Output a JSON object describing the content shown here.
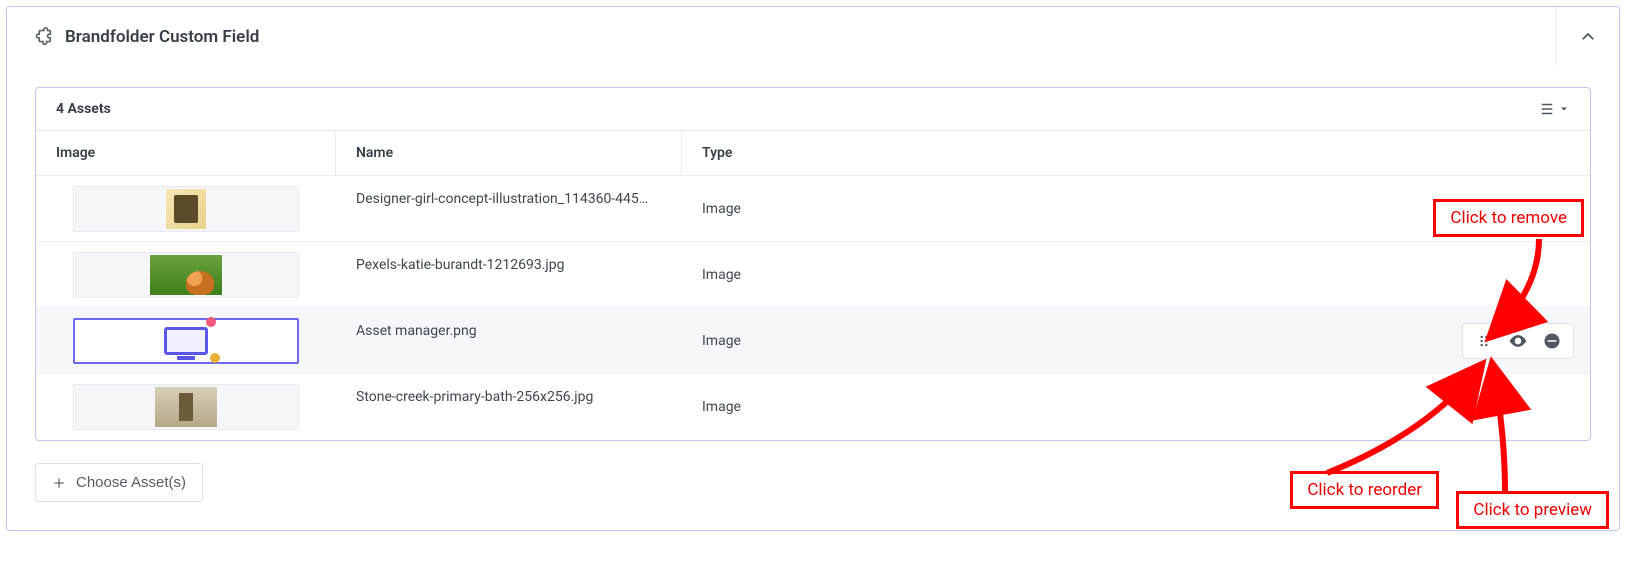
{
  "panel": {
    "title": "Brandfolder Custom Field"
  },
  "assets": {
    "header_text": "4 Assets",
    "columns": {
      "image": "Image",
      "name": "Name",
      "type": "Type"
    },
    "rows": [
      {
        "name": "Designer-girl-concept-illustration_114360-445…",
        "type": "Image",
        "thumb": "img1",
        "selected": false,
        "show_actions": false
      },
      {
        "name": "Pexels-katie-burandt-1212693.jpg",
        "type": "Image",
        "thumb": "img2",
        "selected": false,
        "show_actions": false
      },
      {
        "name": "Asset manager.png",
        "type": "Image",
        "thumb": "img3",
        "selected": true,
        "show_actions": true
      },
      {
        "name": "Stone-creek-primary-bath-256x256.jpg",
        "type": "Image",
        "thumb": "img4",
        "selected": false,
        "show_actions": false
      }
    ]
  },
  "choose_label": "Choose Asset(s)",
  "callouts": {
    "remove": "Click to remove",
    "reorder": "Click to reorder",
    "preview": "Click to preview"
  }
}
